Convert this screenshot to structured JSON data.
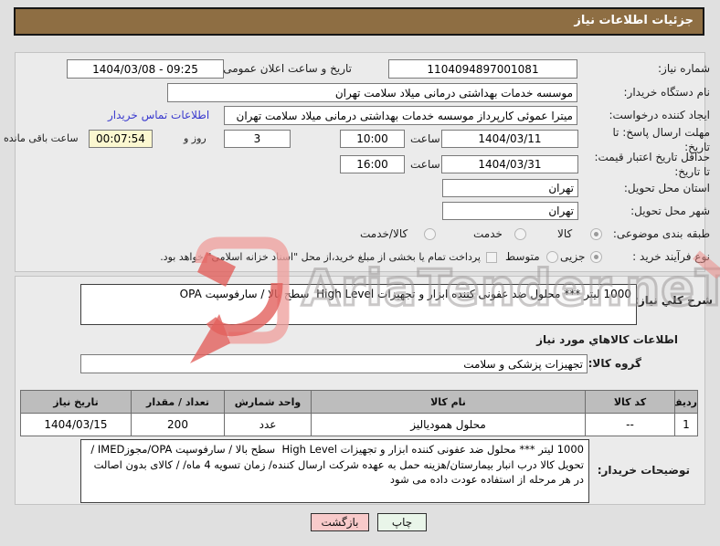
{
  "title_bar": {
    "title": "جزئیات اطلاعات نیاز"
  },
  "form": {
    "need_number": {
      "label": "شماره نیاز:",
      "value": "1104094897001081"
    },
    "announce_datetime": {
      "label": "تاریخ و ساعت اعلان عمومی:",
      "value": "1404/03/08 - 09:25"
    },
    "buyer_name": {
      "label": "نام دستگاه خریدار:",
      "value": "موسسه خدمات بهداشتی درمانی میلاد سلامت تهران"
    },
    "request_creator": {
      "label": "ایجاد کننده درخواست:",
      "value": "میترا عموئی کارپرداز موسسه خدمات بهداشتی درمانی میلاد سلامت تهران",
      "contact_link": "اطلاعات تماس خریدار"
    },
    "response_deadline": {
      "label_line1": "مهلت ارسال پاسخ: تا",
      "label_line2": "تاریخ:",
      "date": "1404/03/11",
      "hour_label": "ساعت",
      "time": "10:00",
      "days_value": "3",
      "days_label": "روز و",
      "time_remaining": "00:07:54",
      "remaining_label": "ساعت باقی مانده"
    },
    "price_validity": {
      "label_line1": "حداقل تاریخ اعتبار قیمت:",
      "label_line2": "تا تاریخ:",
      "date": "1404/03/31",
      "hour_label": "ساعت",
      "time": "16:00"
    },
    "province": {
      "label": "استان محل تحویل:",
      "value": "تهران"
    },
    "city": {
      "label": "شهر محل تحویل:",
      "value": "تهران"
    },
    "subject_class": {
      "label": "طبقه بندی موضوعی:",
      "options": [
        {
          "label": "کالا",
          "selected": true
        },
        {
          "label": "خدمت",
          "selected": false
        },
        {
          "label": "کالا/خدمت",
          "selected": false
        }
      ]
    },
    "purchase_process": {
      "label": "نوع فرآیند خرید :",
      "options": [
        {
          "label": "جزیی",
          "selected": true
        },
        {
          "label": "متوسط",
          "selected": false
        }
      ],
      "checkbox_label": "پرداخت تمام یا بخشی از مبلغ خرید،از محل \"اسناد خزانه اسلامی\" خواهد بود.",
      "checkbox_checked": false
    }
  },
  "need_description": {
    "label": "شرح کلي نیاز:",
    "value": "1000 لیتر *** محلول ضد عفونی کننده ابزار و تجهیزات High Level  سطح بالا / سارفوسپت OPA"
  },
  "goods_section": {
    "header": "اطلاعات کالاهاي مورد نیاز",
    "group_label": "گروه کالا:",
    "group_value": "تجهیزات پزشکی و سلامت",
    "table": {
      "headers": [
        "ردیف",
        "کد کالا",
        "نام کالا",
        "واحد شمارش",
        "تعداد / مقدار",
        "تاریخ نیاز"
      ],
      "rows": [
        [
          "1",
          "--",
          "محلول همودیالیز",
          "عدد",
          "200",
          "1404/03/15"
        ]
      ]
    }
  },
  "buyer_notes": {
    "label": "توضیحات خریدار:",
    "value": "1000 لیتر *** محلول ضد عفونی کننده ابزار و تجهیزات High Level  سطح بالا / سارفوسپت OPA/مجوزIMED /تحویل کالا درب انبار بیمارستان/هزینه حمل به عهده شرکت ارسال کننده/ زمان تسویه 4 ماه/ / کالای بدون اصالت در هر مرحله از استفاده عودت داده می شود"
  },
  "buttons": {
    "back": "بازگشت",
    "print": "چاپ"
  },
  "watermark": {
    "text": "AriaTender.neT"
  },
  "colors": {
    "title_bar_bg": "#8e6e43",
    "link_blue": "#3a3ace",
    "remaining_time_bg": "#fbf7d0",
    "table_header_bg": "#bdbdbd",
    "back_button_bg": "#f8caca",
    "print_button_bg": "#e9f5e9",
    "watermark_red": "#e2605c"
  }
}
